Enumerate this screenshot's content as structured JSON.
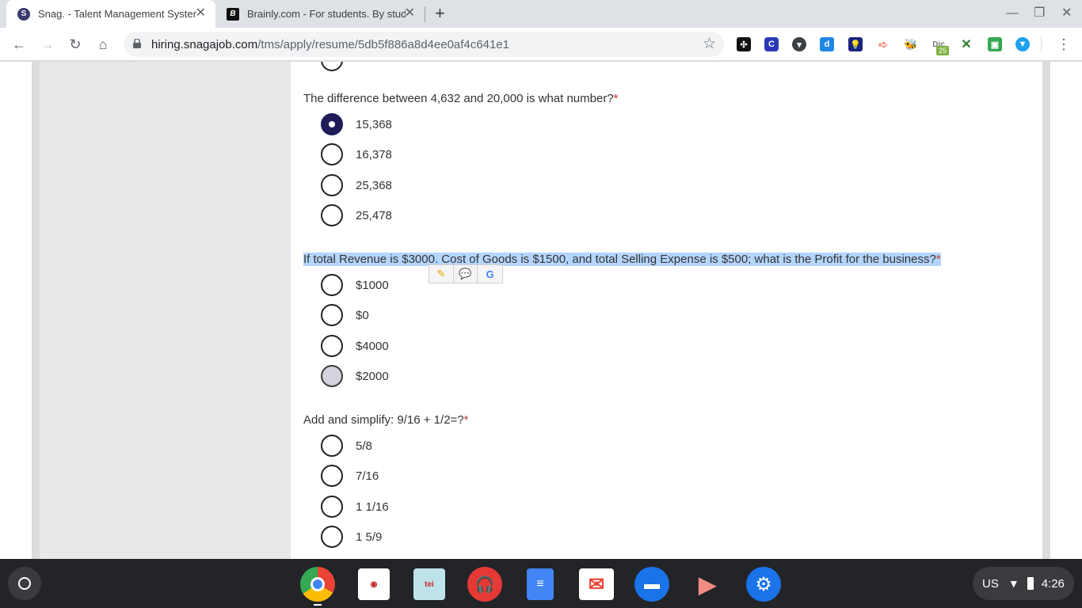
{
  "browser": {
    "tabs": [
      {
        "title": "Snag. - Talent Management System",
        "favicon": "S"
      },
      {
        "title": "Brainly.com - For students. By students",
        "favicon": "B"
      }
    ],
    "url_host": "hiring.snagajob.com",
    "url_path": "/tms/apply/resume/5db5f886a8d4ee0af4c641e1",
    "extension_badge": "25"
  },
  "form": {
    "questions": [
      {
        "text": "The difference between 4,632 and 20,000 is what number?",
        "required": "*",
        "options": [
          "15,368",
          "16,378",
          "25,368",
          "25,478"
        ],
        "selected": "15,368"
      },
      {
        "text": "If total Revenue is $3000. Cost of Goods is $1500, and total Selling Expense is $500; what is the Profit for the business?",
        "required": "*",
        "options": [
          "$1000",
          "$0",
          "$4000",
          "$2000"
        ],
        "hovered": "$2000"
      },
      {
        "text": "Add and simplify: 9/16 + 1/2=?",
        "required": "*",
        "options": [
          "5/8",
          "7/16",
          "1 1/16",
          "1 5/9"
        ]
      }
    ]
  },
  "shelf": {
    "apps": [
      "chrome",
      "screencastify",
      "tei-education",
      "podcast-player",
      "google-docs",
      "gmail",
      "files",
      "screen-recorder",
      "settings"
    ],
    "tray": {
      "locale": "US",
      "time": "4:26"
    }
  },
  "colors": {
    "selected_radio": "#1f1c5a",
    "selection_highlight": "#b4d5fe",
    "required_mark": "#c0392b"
  }
}
